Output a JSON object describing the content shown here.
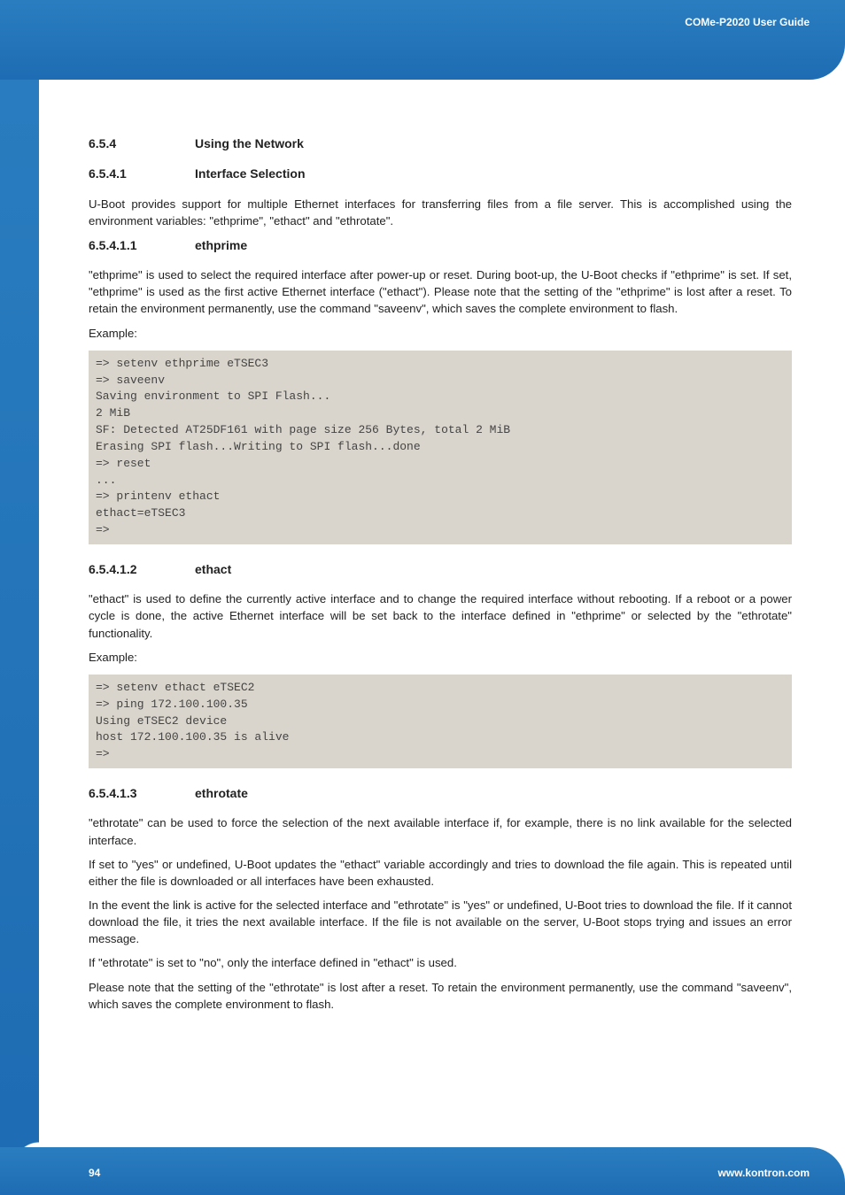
{
  "header": {
    "tag": "COMe-P2020 User Guide"
  },
  "s654": {
    "num": "6.5.4",
    "title": "Using the Network"
  },
  "s6541": {
    "num": "6.5.4.1",
    "title": "Interface Selection",
    "p1": "U-Boot provides support for multiple Ethernet interfaces for transferring files from a file server. This is accomplished using the environment variables: \"ethprime\", \"ethact\" and \"ethrotate\"."
  },
  "s65411": {
    "num": "6.5.4.1.1",
    "title": "ethprime",
    "p1": "\"ethprime\" is used to select the required interface after power-up or reset. During boot-up, the U-Boot checks if \"ethprime\" is set. If set, \"ethprime\" is used as the first active Ethernet interface (\"ethact\"). Please note that the setting of the \"ethprime\" is lost after a reset. To retain the environment permanently, use the command \"saveenv\", which saves the complete environment to flash.",
    "example_label": "Example:",
    "code": "=> setenv ethprime eTSEC3\n=> saveenv\nSaving environment to SPI Flash...\n2 MiB\nSF: Detected AT25DF161 with page size 256 Bytes, total 2 MiB\nErasing SPI flash...Writing to SPI flash...done\n=> reset\n...\n=> printenv ethact\nethact=eTSEC3\n=>"
  },
  "s65412": {
    "num": "6.5.4.1.2",
    "title": "ethact",
    "p1": "\"ethact\" is used to define the currently active interface and to change the required interface without rebooting. If a reboot or a power cycle is done, the active Ethernet interface will be set back to the interface defined in \"ethprime\" or selected by the \"ethrotate\" functionality.",
    "example_label": "Example:",
    "code": "=> setenv ethact eTSEC2\n=> ping 172.100.100.35\nUsing eTSEC2 device\nhost 172.100.100.35 is alive\n=>"
  },
  "s65413": {
    "num": "6.5.4.1.3",
    "title": "ethrotate",
    "p1": "\"ethrotate\" can be used to force the selection of the next available interface if, for example, there is no link available for the selected interface.",
    "p2": "If set to \"yes\" or undefined, U-Boot updates the \"ethact\" variable accordingly and tries to download the file again. This is repeated until either the file is downloaded or all interfaces have been exhausted.",
    "p3": "In the event the link is active for the selected interface and \"ethrotate\" is \"yes\" or undefined, U-Boot tries to download the file. If it cannot download the file, it tries the next available interface. If the file is not available on the server, U-Boot stops trying and issues an error message.",
    "p4": "If \"ethrotate\" is set to \"no\", only the interface defined in \"ethact\" is used.",
    "p5": "Please note that the setting of the \"ethrotate\" is lost after a reset. To retain the environment permanently, use the command \"saveenv\", which saves the complete environment to flash."
  },
  "footer": {
    "page": "94",
    "url": "www.kontron.com"
  }
}
